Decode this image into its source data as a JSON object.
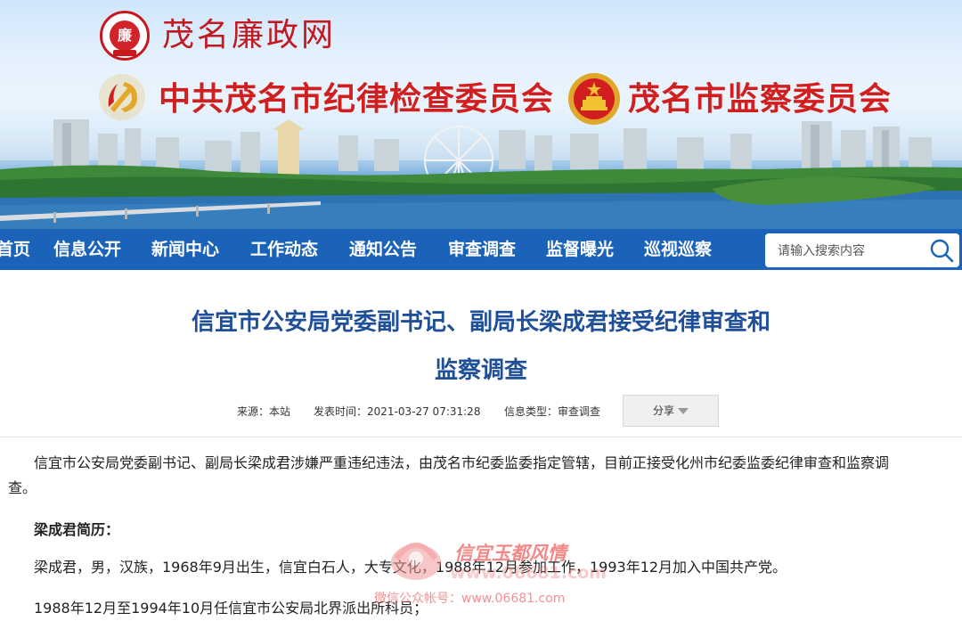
{
  "header": {
    "site_name": "茂名廉政网",
    "org_discipline": "中共茂名市纪律检查委员会",
    "org_supervision": "茂名市监察委员会"
  },
  "nav": {
    "items": [
      {
        "label": "首页"
      },
      {
        "label": "信息公开"
      },
      {
        "label": "新闻中心"
      },
      {
        "label": "工作动态"
      },
      {
        "label": "通知公告"
      },
      {
        "label": "审查调查"
      },
      {
        "label": "监督曝光"
      },
      {
        "label": "巡视巡察"
      }
    ],
    "search_placeholder": "请输入搜索内容"
  },
  "article": {
    "title_line1": "信宜市公安局党委副书记、副局长梁成君接受纪律审查和",
    "title_line2": "监察调查",
    "meta": {
      "source": "来源：本站",
      "published": "发表时间：2021-03-27 07:31:28",
      "category": "信息类型：审查调查"
    },
    "share_label": "分享",
    "paragraphs": {
      "p1_line1": "信宜市公安局党委副书记、副局长梁成君涉嫌严重违纪违法，由茂名市纪委监委指定管辖，目前正接受化州市纪委监委纪律审查和监察调",
      "p1_line2": "查。",
      "resume_heading": "梁成君简历：",
      "p2": "梁成君，男，汉族，1968年9月出生，信宜白石人，大专文化，1988年12月参加工作，1993年12月加入中国共产党。",
      "p3": "1988年12月至1994年10月任信宜市公安局北界派出所科员；"
    }
  },
  "watermark": {
    "name": "信宜玉都风情",
    "url": "www.06681.com",
    "sub": "微信公众帐号：www.06681.com"
  },
  "colors": {
    "nav_bg": "#1a63b8",
    "title_blue": "#1e4f98",
    "banner_red": "#d11e1e",
    "watermark_red": "#ef6b6b"
  }
}
